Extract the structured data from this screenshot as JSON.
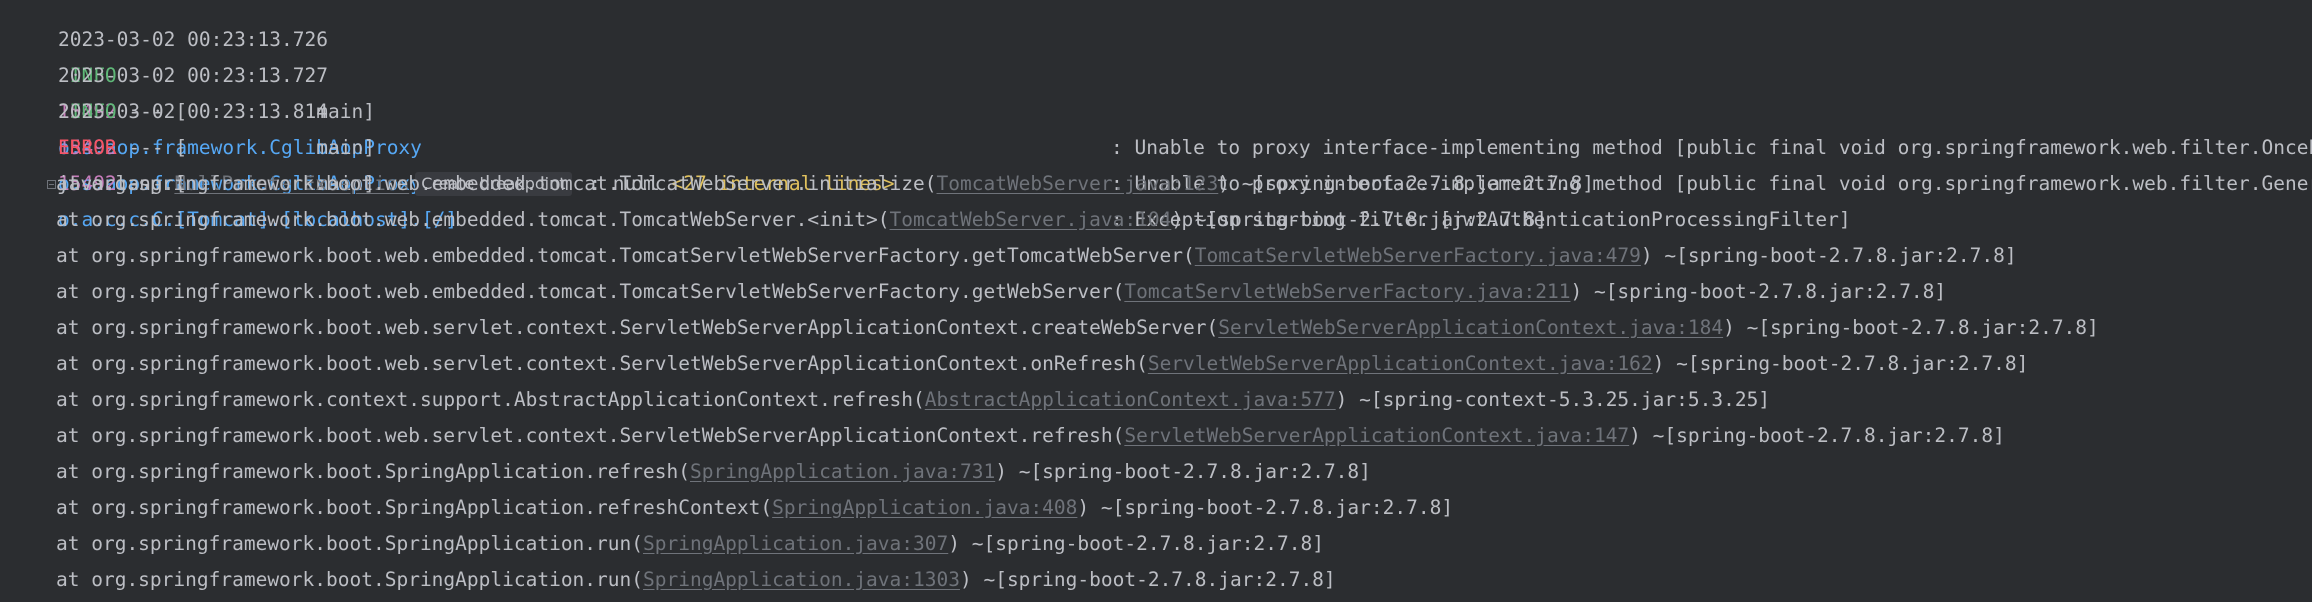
{
  "log_lines": [
    {
      "timestamp": "2023-03-02 00:23:13.726",
      "level": " INFO",
      "pid": "15492",
      "sep": " --- [",
      "thread": "           main]",
      "logger": "o.s.aop.framework.CglibAopProxy",
      "message": ": Unable to proxy interface-implementing method [public final void org.springframework.web.filter.OncePerRequestFilter.doFilter(javax.servlet.ServletRequest,javax.servlet.ServletResponse,javax.servlet.FilterChain)"
    },
    {
      "timestamp": "2023-03-02 00:23:13.727",
      "level": " INFO",
      "pid": "15492",
      "sep": " --- [",
      "thread": "           main]",
      "logger": "o.s.aop.framework.CglibAopProxy",
      "message": ": Unable to proxy interface-implementing method [public final void org.springframework.web.filter.GenericFilterBean.init(javax.servlet.FilterConfig)"
    },
    {
      "timestamp": "2023-03-02 00:23:13.814",
      "level": "ERROR",
      "pid": "15492",
      "sep": " --- [",
      "thread": "           main]",
      "logger": "o.a.c.c.C.[Tomcat].[localhost].[/]",
      "message": ": Exception starting filter [jwtAuthenticationProcessingFilter]"
    }
  ],
  "exception": {
    "class_prefix": "java.lang.",
    "class_link": "NullPointerException",
    "hint": "Create breakpoint",
    "message": " : null ",
    "internal": "<27 internal lines>"
  },
  "trace_lines": [
    {
      "prefix": "at org.springframework.boot.web.embedded.tomcat.TomcatWebServer.initialize(",
      "link": "TomcatWebServer.java:123",
      "suffix": ") ~[spring-boot-2.7.8.jar:2.7.8]"
    },
    {
      "prefix": "at org.springframework.boot.web.embedded.tomcat.TomcatWebServer.<init>(",
      "link": "TomcatWebServer.java:104",
      "suffix": ") ~[spring-boot-2.7.8.jar:2.7.8]"
    },
    {
      "prefix": "at org.springframework.boot.web.embedded.tomcat.TomcatServletWebServerFactory.getTomcatWebServer(",
      "link": "TomcatServletWebServerFactory.java:479",
      "suffix": ") ~[spring-boot-2.7.8.jar:2.7.8]"
    },
    {
      "prefix": "at org.springframework.boot.web.embedded.tomcat.TomcatServletWebServerFactory.getWebServer(",
      "link": "TomcatServletWebServerFactory.java:211",
      "suffix": ") ~[spring-boot-2.7.8.jar:2.7.8]"
    },
    {
      "prefix": "at org.springframework.boot.web.servlet.context.ServletWebServerApplicationContext.createWebServer(",
      "link": "ServletWebServerApplicationContext.java:184",
      "suffix": ") ~[spring-boot-2.7.8.jar:2.7.8]"
    },
    {
      "prefix": "at org.springframework.boot.web.servlet.context.ServletWebServerApplicationContext.onRefresh(",
      "link": "ServletWebServerApplicationContext.java:162",
      "suffix": ") ~[spring-boot-2.7.8.jar:2.7.8]"
    },
    {
      "prefix": "at org.springframework.context.support.AbstractApplicationContext.refresh(",
      "link": "AbstractApplicationContext.java:577",
      "suffix": ") ~[spring-context-5.3.25.jar:5.3.25]"
    },
    {
      "prefix": "at org.springframework.boot.web.servlet.context.ServletWebServerApplicationContext.refresh(",
      "link": "ServletWebServerApplicationContext.java:147",
      "suffix": ") ~[spring-boot-2.7.8.jar:2.7.8]"
    },
    {
      "prefix": "at org.springframework.boot.SpringApplication.refresh(",
      "link": "SpringApplication.java:731",
      "suffix": ") ~[spring-boot-2.7.8.jar:2.7.8]"
    },
    {
      "prefix": "at org.springframework.boot.SpringApplication.refreshContext(",
      "link": "SpringApplication.java:408",
      "suffix": ") ~[spring-boot-2.7.8.jar:2.7.8]"
    },
    {
      "prefix": "at org.springframework.boot.SpringApplication.run(",
      "link": "SpringApplication.java:307",
      "suffix": ") ~[spring-boot-2.7.8.jar:2.7.8]"
    },
    {
      "prefix": "at org.springframework.boot.SpringApplication.run(",
      "link": "SpringApplication.java:1303",
      "suffix": ") ~[spring-boot-2.7.8.jar:2.7.8]"
    }
  ],
  "colors": {
    "background": "#2b2d30",
    "text": "#bcbec4",
    "info": "#5fb878",
    "error": "#f75464",
    "pid": "#c77dbb",
    "logger": "#56a8f5",
    "link": "#6f737a",
    "internal": "#e0c15e"
  },
  "icons": {
    "fold": "fold-toggle-icon"
  }
}
